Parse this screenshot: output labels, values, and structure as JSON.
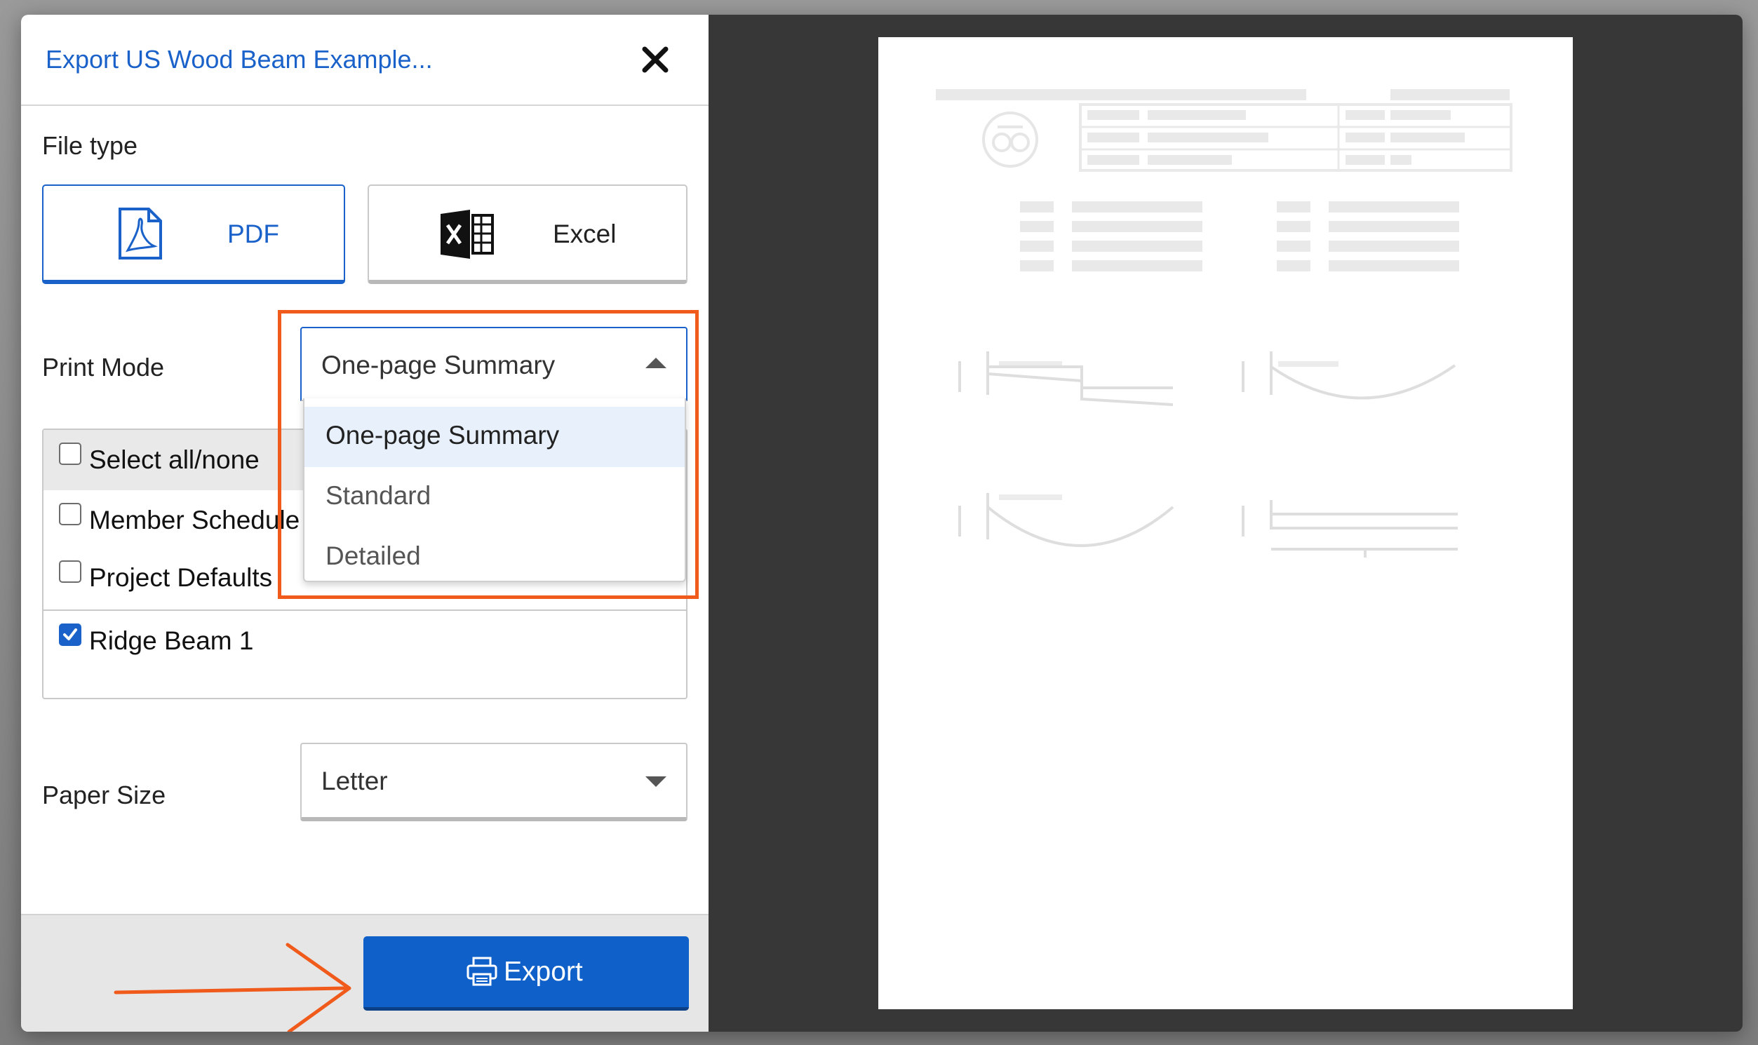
{
  "dialog": {
    "title": "Export US Wood Beam Example...",
    "file_type_label": "File type",
    "file_types": [
      {
        "label": "PDF",
        "icon": "pdf-file-icon",
        "active": true
      },
      {
        "label": "Excel",
        "icon": "excel-file-icon",
        "active": false
      }
    ],
    "print_mode": {
      "label": "Print Mode",
      "value": "One-page Summary",
      "options": [
        "One-page Summary",
        "Standard",
        "Detailed"
      ],
      "expanded": true
    },
    "sections": [
      {
        "label": "Select all/none",
        "checked": false
      },
      {
        "label": "Member Schedule",
        "checked": false
      },
      {
        "label": "Project Defaults",
        "checked": false
      },
      {
        "label": "Ridge Beam 1",
        "checked": true
      }
    ],
    "paper_size": {
      "label": "Paper Size",
      "value": "Letter"
    },
    "export_button": "Export"
  },
  "colors": {
    "accent": "#1a62c9",
    "annotation": "#f05a1a",
    "modal_dark": "#373737"
  }
}
